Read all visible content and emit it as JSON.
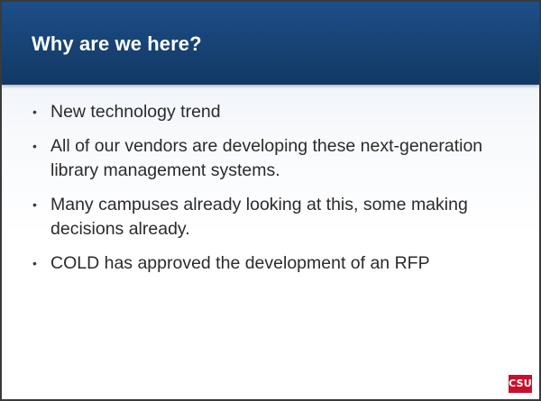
{
  "slide": {
    "title": "Why are we here?",
    "bullets": [
      "New technology trend",
      "All of our vendors are developing these next-generation library management systems.",
      "Many campuses already looking at this, some making decisions already.",
      "COLD has approved the development of an RFP"
    ],
    "bullet_glyph": "•",
    "logo_text": "CSU"
  },
  "colors": {
    "title_bar": "#164172",
    "logo_red": "#c8102e",
    "body_text": "#2b2b2b"
  }
}
